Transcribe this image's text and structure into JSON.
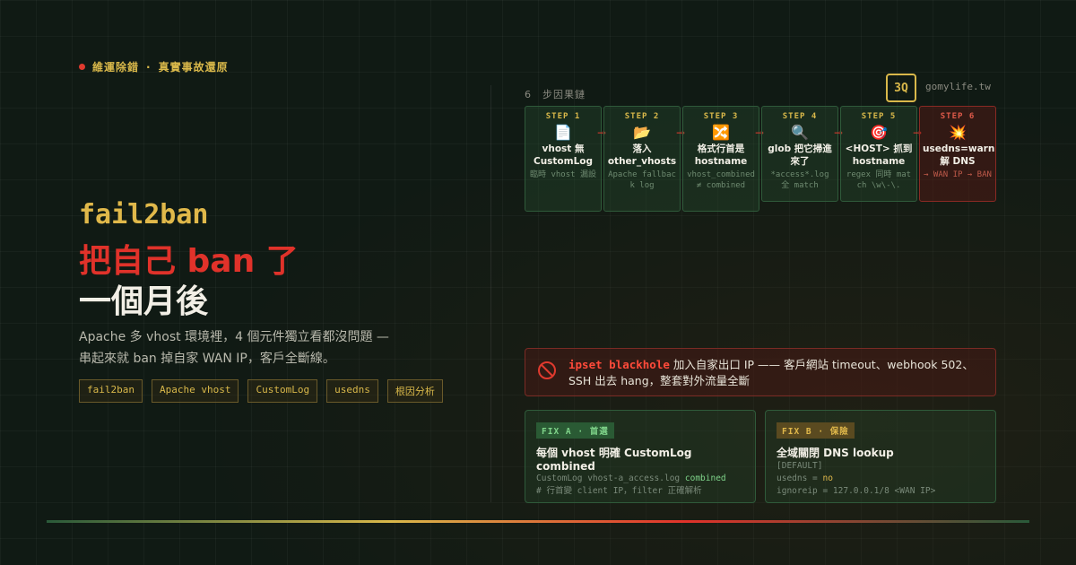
{
  "eyebrow": {
    "part1": "維運除錯",
    "sep": "·",
    "part2": "真實事故還原"
  },
  "hero": {
    "title_line1": "fail2ban",
    "title_line2": "把自己 ban 了",
    "title_line3": "一個月後",
    "description": "Apache 多 vhost 環境裡，4 個元件獨立看都沒問題 — 串起來就 ban 掉自家 WAN IP，客戶全斷線。"
  },
  "tags": [
    "fail2ban",
    "Apache vhost",
    "CustomLog",
    "usedns",
    "根因分析"
  ],
  "brand": {
    "badge": "3Q",
    "site": "gomylife.tw"
  },
  "steps_label": "6　步因果鏈",
  "steps": [
    {
      "num": "STEP 1",
      "icon": "📄",
      "title": "vhost 無 CustomLog",
      "sub": "臨時 vhost 漏設"
    },
    {
      "num": "STEP 2",
      "icon": "📂",
      "title": "落入 other_vhosts",
      "sub": "Apache fallback log"
    },
    {
      "num": "STEP 3",
      "icon": "🔀",
      "title": "格式行首是 hostname",
      "sub": "vhost_combined ≠ combined"
    },
    {
      "num": "STEP 4",
      "icon": "🔍",
      "title": "glob 把它掃進來了",
      "sub": "*access*.log 全 match"
    },
    {
      "num": "STEP 5",
      "icon": "🎯",
      "title": "<HOST> 抓到 hostname",
      "sub": "regex 同時 match \\w\\-\\."
    },
    {
      "num": "STEP 6",
      "icon": "💥",
      "title": "usedns=warn 解 DNS",
      "sub": "→ WAN IP → BAN"
    }
  ],
  "alert": {
    "key": "ipset blackhole",
    "text": " 加入自家出口 IP —— 客戶網站 timeout、webhook 502、SSH 出去 hang，整套對外流量全斷"
  },
  "fix_a": {
    "tag": "FIX A · 首選",
    "title": "每個 vhost 明確 CustomLog combined",
    "line1_prefix": "CustomLog vhost-a_access.log ",
    "line1_hl": "combined",
    "line2": "# 行首變 client IP，filter 正確解析"
  },
  "fix_b": {
    "tag": "FIX B · 保險",
    "title": "全域關閉 DNS lookup",
    "line1": "[DEFAULT]",
    "line2_prefix": "usedns = ",
    "line2_hl": "no",
    "line3": "ignoreip = 127.0.0.1/8 <WAN IP>"
  },
  "colors": {
    "accent": "#d9b84a",
    "danger": "#e0322a",
    "ok": "#7fd48a"
  }
}
